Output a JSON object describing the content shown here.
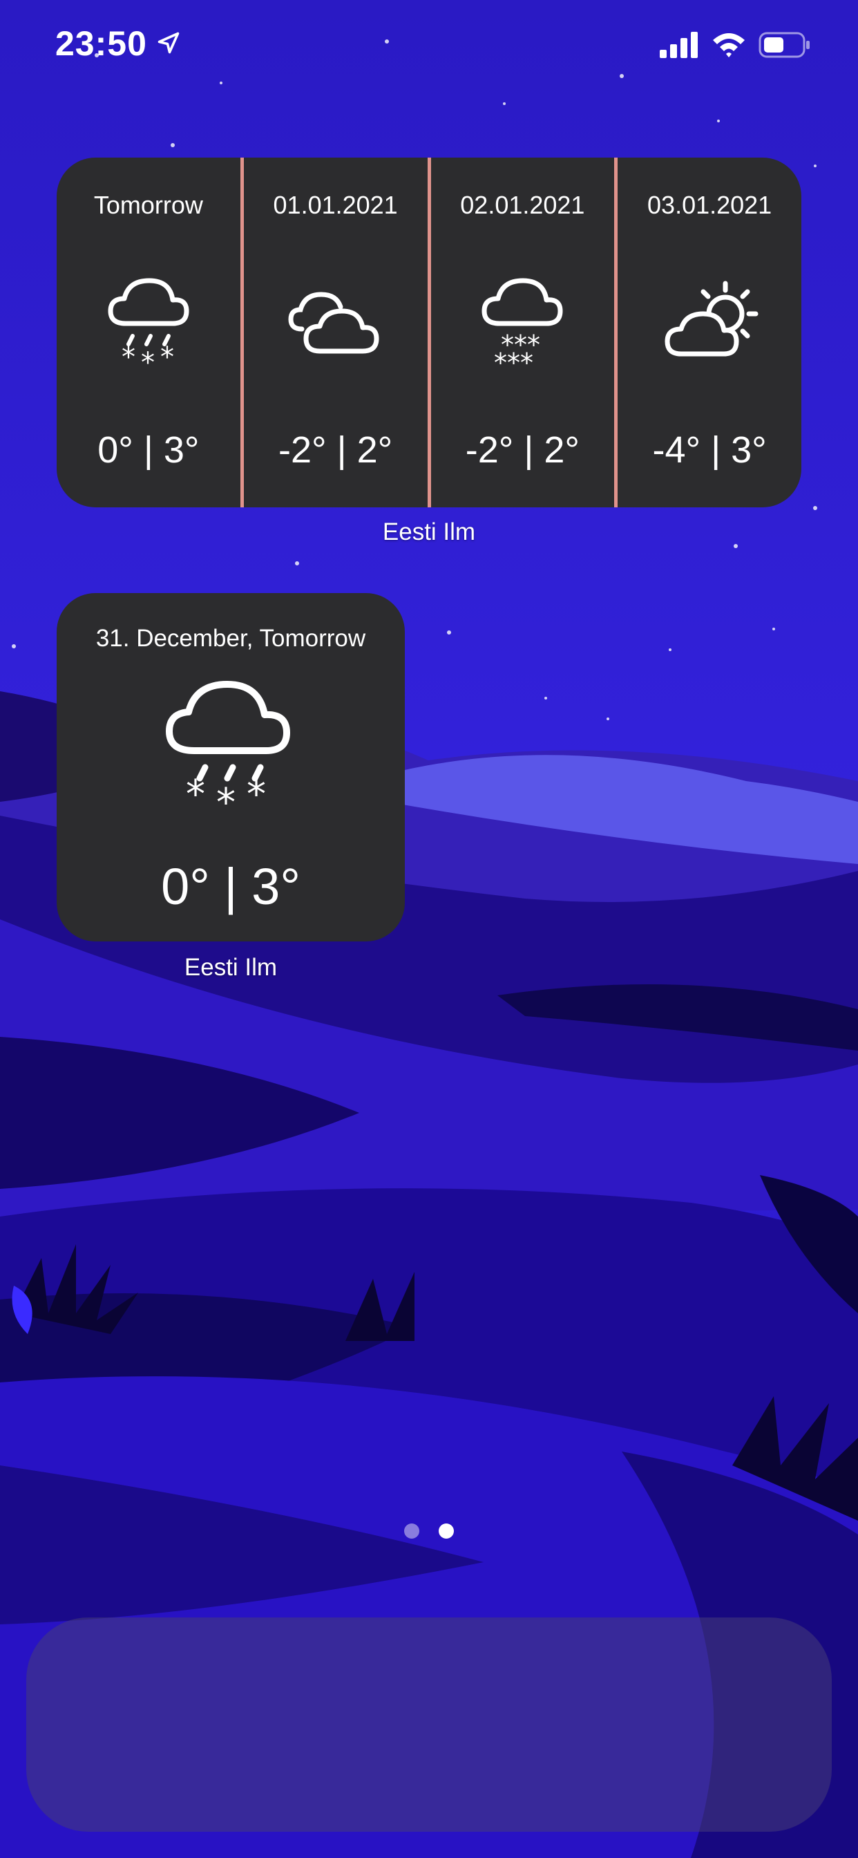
{
  "status_bar": {
    "time": "23:50"
  },
  "forecast_widget": {
    "days": [
      {
        "label": "Tomorrow",
        "icon": "snow-rain-icon",
        "temp": "0° | 3°"
      },
      {
        "label": "01.01.2021",
        "icon": "cloudy-icon",
        "temp": "-2° | 2°"
      },
      {
        "label": "02.01.2021",
        "icon": "snow-icon",
        "temp": "-2° | 2°"
      },
      {
        "label": "03.01.2021",
        "icon": "partly-sunny-icon",
        "temp": "-4° | 3°"
      }
    ],
    "caption": "Eesti Ilm",
    "divider_color": "#e0938c"
  },
  "today_widget": {
    "label": "31. December, Tomorrow",
    "icon": "snow-rain-icon",
    "temp": "0° | 3°",
    "caption": "Eesti Ilm"
  },
  "page_indicator": {
    "count": 2,
    "active": 2
  },
  "colors": {
    "widget_bg": "#2c2c2e",
    "wallpaper_base": "#2a14c8"
  }
}
